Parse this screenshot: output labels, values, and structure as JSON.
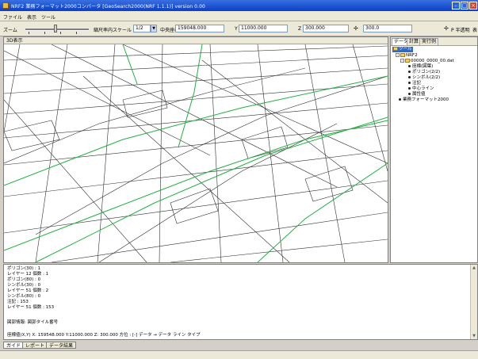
{
  "window": {
    "title": "NRF2 業務フォーマット2000コンバータ [GeoSearch2000(NRF 1.1.1)] version 0.00",
    "icon": "app-icon",
    "controls": [
      "minimize-icon",
      "maximize-icon",
      "close-icon"
    ]
  },
  "menu": {
    "items": [
      "ファイル",
      "表示",
      "ツール"
    ]
  },
  "toolbar": {
    "zoom_label": "ズーム",
    "scale_label": "縮尺率内スケール",
    "scale_value": "1/2",
    "extent_label": "中央座標",
    "extent_value": "159048.000",
    "y_label": "Y",
    "y_value": "11000.000",
    "z_label": "Z",
    "z_value": "300.000",
    "angle_value": "300.0",
    "display_button": "P 半透明",
    "extra_label": "表"
  },
  "map_panel": {
    "header": "3D表示",
    "road_color": "#20b040",
    "line_color": "#303030"
  },
  "right_panel": {
    "tabs": [
      "データ",
      "計算",
      "実行例"
    ],
    "tree": [
      {
        "label": "ツール",
        "selected": true,
        "indent": 0,
        "type": "folder"
      },
      {
        "label": "NRF2",
        "indent": 1,
        "type": "folder",
        "toggle": "-"
      },
      {
        "label": "00000_0000_00.dat",
        "indent": 2,
        "type": "folder",
        "toggle": "-"
      },
      {
        "label": "座標(図葉)",
        "indent": 3,
        "type": "dot"
      },
      {
        "label": "ポリゴン(2/2)",
        "indent": 3,
        "type": "dot"
      },
      {
        "label": "シンボル(2/2)",
        "indent": 3,
        "type": "dot"
      },
      {
        "label": "注記",
        "indent": 3,
        "type": "dot"
      },
      {
        "label": "中心ライン",
        "indent": 3,
        "type": "dot"
      },
      {
        "label": "属性値",
        "indent": 3,
        "type": "dot"
      },
      {
        "label": "業務フォーマット2000",
        "indent": 1,
        "type": "dot"
      }
    ]
  },
  "info_panel": {
    "lines": [
      "ポリゴン(30) : 1",
      "    レイヤー 12 個数 : 1",
      "ポリゴン(80) : 0",
      "シンボル(30) : 0",
      "    レイヤー 51 個数 : 2",
      "シンボル(80) : 0",
      "注記 : 153",
      "    レイヤー 51 個数 : 153",
      "",
      "図郭情報: 図郭タイル番号",
      "",
      "座標値(X,Y)  X: 159548.000  Y:11000.000  Z: 300.000  方位 : [-] データ  →  データ  ライン  タイプ"
    ]
  },
  "bottom_tabs": [
    "ガイド",
    "レポート",
    "データ結果"
  ]
}
